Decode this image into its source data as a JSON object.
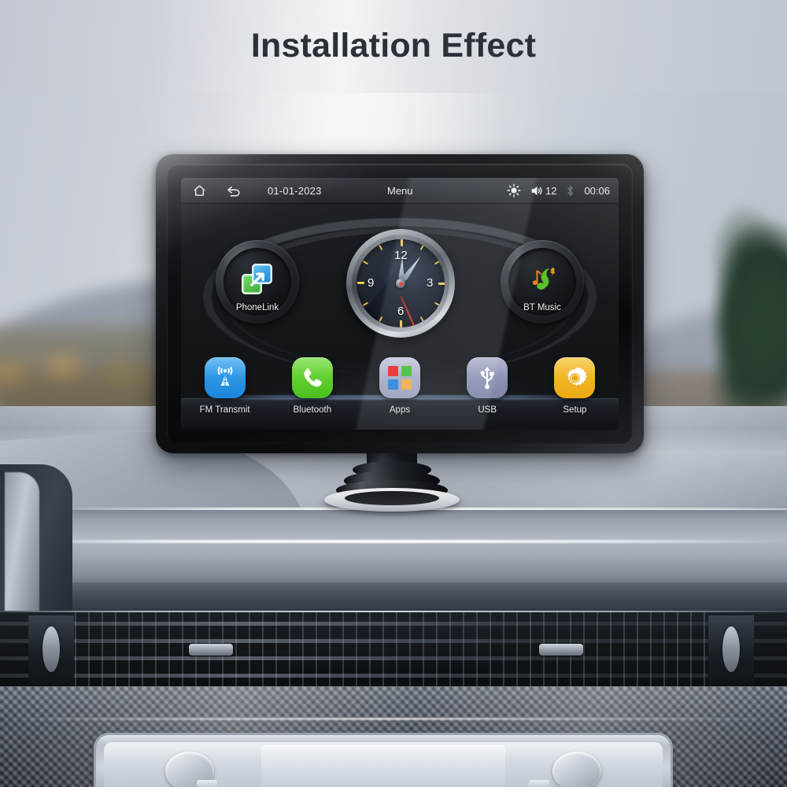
{
  "page": {
    "title": "Installation Effect",
    "title_color": "#2c3039"
  },
  "device": {
    "statusbar": {
      "home_icon": "home-icon",
      "back_icon": "back-arrow-icon",
      "date": "01-01-2023",
      "menu_label": "Menu",
      "brightness_icon": "brightness-sun-icon",
      "volume_icon": "speaker-icon",
      "volume_value": "12",
      "bluetooth_icon": "bluetooth-icon",
      "clock_time": "00:06"
    },
    "widgets": [
      {
        "name": "phonelink",
        "label": "PhoneLink",
        "icon": "phonelink-icon",
        "colors": {
          "green": "#35a83a",
          "blue": "#1b82d8"
        }
      },
      {
        "name": "clock",
        "label": "",
        "icon": "analog-clock-icon",
        "numerals": [
          "12",
          "3",
          "6",
          "9"
        ],
        "hour_angle": 3,
        "minute_angle": 36,
        "second_angle": 156,
        "tick_color": "#d8b93f",
        "second_hand_color": "#e23c2a"
      },
      {
        "name": "bt-music",
        "label": "BT Music",
        "icon": "bt-music-icon",
        "colors": {
          "note": "#5ec12b",
          "accent": "#e8821f"
        }
      }
    ],
    "dock": [
      {
        "name": "fm-transmit",
        "label": "FM Transmit",
        "icon": "radio-tower-icon",
        "color": "#2196e8"
      },
      {
        "name": "bluetooth",
        "label": "Bluetooth",
        "icon": "phone-handset-icon",
        "color": "#5bd127"
      },
      {
        "name": "apps",
        "label": "Apps",
        "icon": "apps-grid-icon",
        "color": "#a7abc4",
        "tile_colors": [
          "#e0413f",
          "#55c24a",
          "#3d8fe0",
          "#efb45c"
        ]
      },
      {
        "name": "usb",
        "label": "USB",
        "icon": "usb-icon",
        "color": "#8d93b5"
      },
      {
        "name": "setup",
        "label": "Setup",
        "icon": "gear-icon",
        "color": "#f0b323"
      }
    ]
  },
  "mount": {
    "name": "suction-pedestal-mount",
    "pad_color": "#dde1e5"
  },
  "scene": {
    "name": "car-dashboard-interior",
    "elements": [
      "sky",
      "distant-hill",
      "autumn-trees",
      "conifer-tree",
      "dashboard",
      "air-vent",
      "carbon-fiber-trim",
      "center-console"
    ]
  }
}
